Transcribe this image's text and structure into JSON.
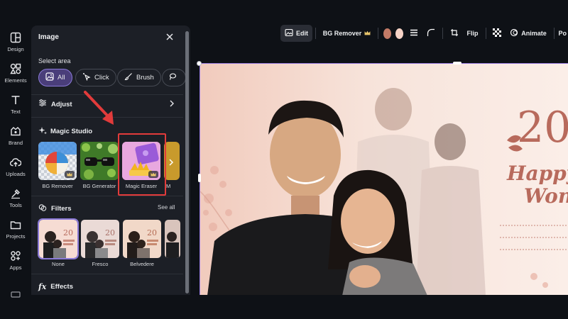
{
  "rail": {
    "items": [
      {
        "label": "Design",
        "icon": "design-icon"
      },
      {
        "label": "Elements",
        "icon": "elements-icon"
      },
      {
        "label": "Text",
        "icon": "text-icon"
      },
      {
        "label": "Brand",
        "icon": "brand-icon"
      },
      {
        "label": "Uploads",
        "icon": "uploads-icon"
      },
      {
        "label": "Tools",
        "icon": "tools-icon"
      },
      {
        "label": "Projects",
        "icon": "projects-icon"
      },
      {
        "label": "Apps",
        "icon": "apps-icon"
      }
    ]
  },
  "panel": {
    "title": "Image",
    "select_area_title": "Select area",
    "select_chips": [
      {
        "label": "All",
        "active": true,
        "icon": "image-select-icon"
      },
      {
        "label": "Click",
        "active": false,
        "icon": "magic-click-icon"
      },
      {
        "label": "Brush",
        "active": false,
        "icon": "brush-icon"
      }
    ],
    "adjust_label": "Adjust",
    "magic_studio_title": "Magic Studio",
    "magic_tools": [
      {
        "label": "BG Remover",
        "premium": true
      },
      {
        "label": "BG Generator",
        "premium": false
      },
      {
        "label": "Magic Eraser",
        "premium": true,
        "highlighted": true
      },
      {
        "label": "M",
        "premium": false
      }
    ],
    "filters_title": "Filters",
    "see_all": "See all",
    "filters": [
      {
        "label": "None",
        "active": true
      },
      {
        "label": "Fresco",
        "active": false
      },
      {
        "label": "Belvedere",
        "active": false
      }
    ],
    "effects_label": "Effects"
  },
  "toolbar": {
    "edit": "Edit",
    "bg_remover": "BG Remover",
    "flip": "Flip",
    "animate": "Animate",
    "overflow": "Po",
    "swatch_colors": [
      "#c27a66",
      "#f6d3c6"
    ]
  },
  "canvas": {
    "year": "20",
    "happy": "Happy",
    "wom": "Won"
  },
  "colors": {
    "accent": "#8b7ad8",
    "highlight": "#e23b3b",
    "canvas_bg": "#f7e3da",
    "title_rose": "#b86a5c"
  }
}
